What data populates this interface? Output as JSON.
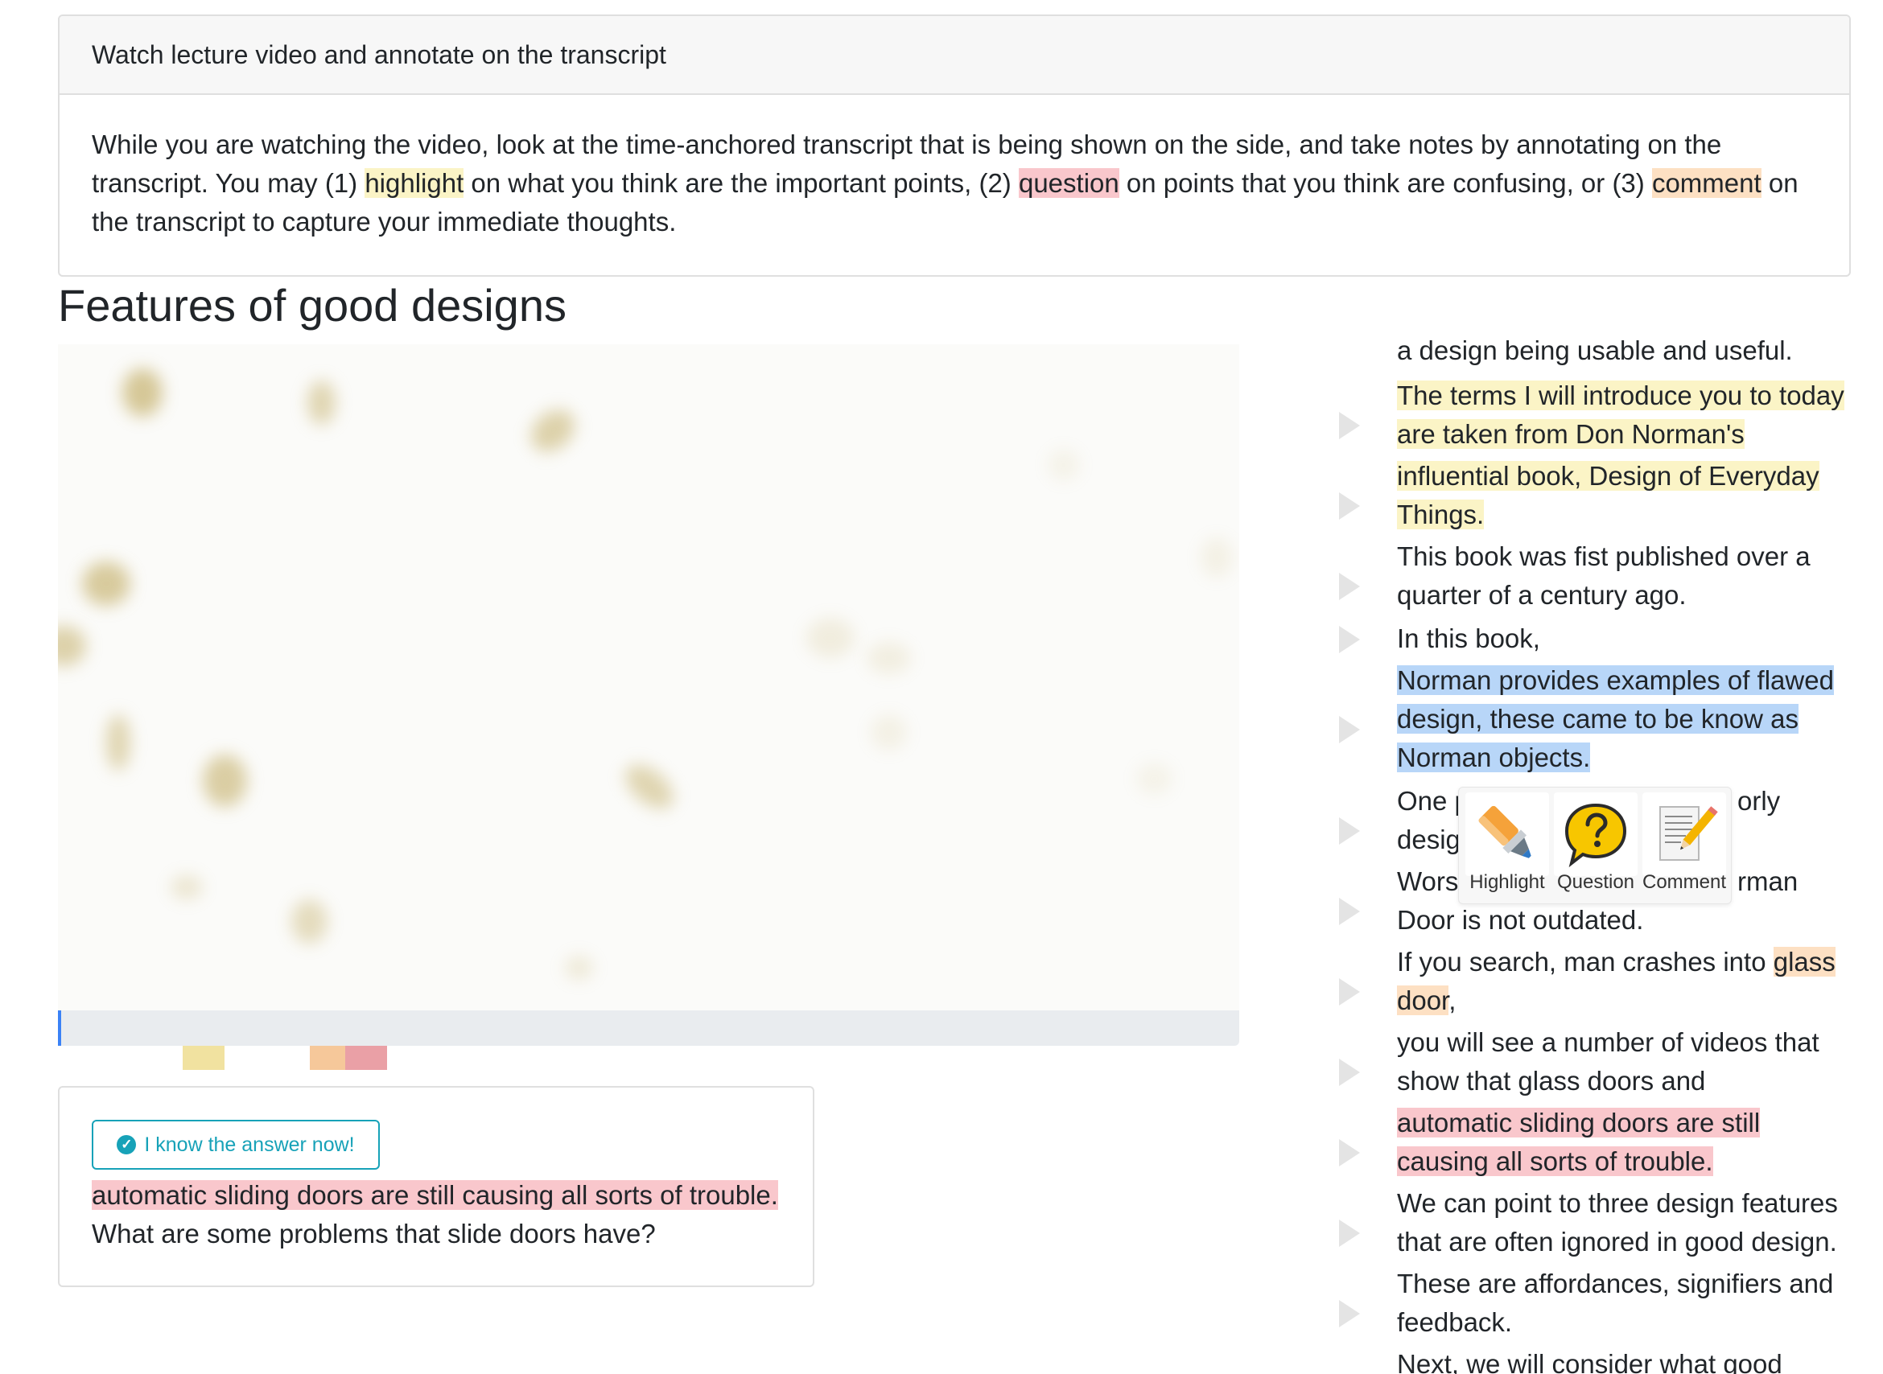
{
  "instructions": {
    "header": "Watch lecture video and annotate on the transcript",
    "body_line1": "While you are watching the video, look at the time-anchored transcript that is being shown on the side, and take notes by annotating on the",
    "body_line2_a": "transcript. You may (1) ",
    "highlight_word": "highlight",
    "body_line2_b": " on what you think are the important points, (2) ",
    "question_word": "question",
    "body_line2_c": " on points that you think are confusing, or (3) ",
    "comment_word": "comment",
    "body_line2_d": " on",
    "body_line3": "the transcript to capture your immediate thoughts."
  },
  "page_title": "Features of good designs",
  "video": {
    "progress_fraction": 0.002,
    "markers": [
      {
        "type": "highlight",
        "color": "#f1e2a0"
      },
      {
        "type": "comment",
        "color": "#f6c89a"
      },
      {
        "type": "question",
        "color": "#eaa0a6"
      }
    ]
  },
  "question_card": {
    "button_label": "I know the answer now!",
    "quote": "automatic sliding doors are still causing all sorts of trouble.",
    "question": "What are some problems that slide doors have?"
  },
  "transcript": {
    "segments": [
      {
        "lines": [
          "a design being usable and useful."
        ]
      },
      {
        "lines": [
          "The terms I will introduce you to today",
          "are taken from Don Norman's"
        ],
        "annotation": "highlight"
      },
      {
        "lines": [
          "influential book, Design of Everyday",
          "Things."
        ],
        "annotation": "highlight"
      },
      {
        "lines": [
          "This book was fist published over a",
          "quarter of a century ago."
        ]
      },
      {
        "lines": [
          "In this book,"
        ]
      },
      {
        "lines": [
          "Norman provides examples of flawed",
          "design, these came to be know as",
          "Norman objects."
        ],
        "annotation": "selected"
      },
      {
        "lines": [
          "One p",
          "desig"
        ],
        "line1_right": "orly"
      },
      {
        "lines": [
          "Worse",
          "Door is not outdated."
        ],
        "line1_right": "rman"
      },
      {
        "lines_prefix": "If you search, man crashes into ",
        "comment_text": "glass",
        "line2_comment": "door",
        "line2_rest": ","
      },
      {
        "lines": [
          "you will see a number of videos that",
          "show that glass doors and"
        ]
      },
      {
        "lines": [
          "automatic sliding doors are still",
          "causing all sorts of trouble."
        ],
        "annotation": "question"
      },
      {
        "lines": [
          "We can point to three design features",
          "that are often ignored in good design."
        ]
      },
      {
        "lines": [
          "These are affordances, signifiers and",
          "feedback."
        ]
      },
      {
        "lines": [
          "Next, we will consider what good"
        ]
      }
    ]
  },
  "annotation_toolbar": {
    "highlight_label": "Highlight",
    "question_label": "Question",
    "comment_label": "Comment",
    "icons": [
      "highlighter-icon",
      "question-bubble-icon",
      "comment-note-icon"
    ]
  },
  "colors": {
    "highlight": "#fbf4c6",
    "question": "#f9c7cc",
    "comment": "#fde0c3",
    "selection": "#b8d6f8",
    "accent": "#17a2b8"
  }
}
